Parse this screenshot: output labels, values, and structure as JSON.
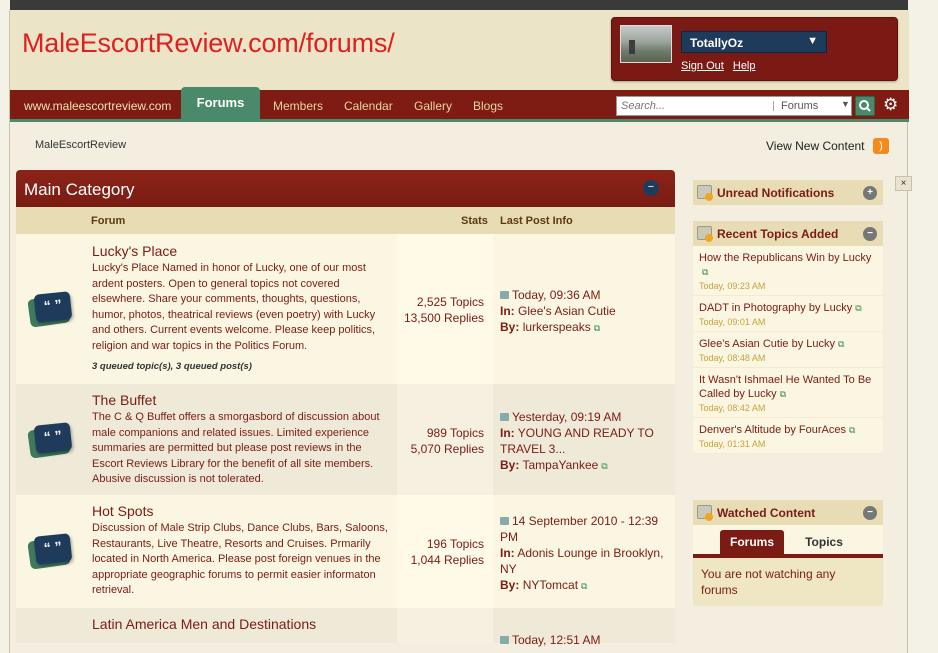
{
  "header": {
    "site_title": "MaleEscortReview.com/forums/",
    "username": "TotallyOz",
    "sign_out": "Sign Out",
    "help": "Help"
  },
  "nav": {
    "home": "www.maleescortreview.com",
    "items": [
      "Forums",
      "Members",
      "Calendar",
      "Gallery",
      "Blogs"
    ]
  },
  "search": {
    "placeholder": "Search...",
    "scope": "Forums"
  },
  "breadcrumb": "MaleEscortReview",
  "view_new": "View New Content",
  "category": {
    "title": "Main Category",
    "col_forum": "Forum",
    "col_stats": "Stats",
    "col_last": "Last Post Info"
  },
  "forums": [
    {
      "title": "Lucky's Place",
      "desc": "Lucky's Place Named in honor of Lucky, one of our most ardent posters. Open to general topics not covered elsewhere. Share your comments, thoughts, questions, humor, photos, theatrical reviews (even poetry) with Lucky and others. Current events welcome. Please keep politics, religion and war topics in the Politics Forum.",
      "queued": "3 queued topic(s), 3 queued post(s)",
      "topics": "2,525 Topics",
      "replies": "13,500 Replies",
      "last_time": "Today, 09:36 AM",
      "last_in": "Glee's Asian Cutie",
      "last_by": "lurkerspeaks"
    },
    {
      "title": "The Buffet",
      "desc": "The C & Q Buffet offers a smorgasbord of discussion about male companions and related issues. Limited experience summaries are permitted but please post reviews in the Escort Reviews Library for the benefit of all site members. Abusive discussion is not tolerated.",
      "topics": "989 Topics",
      "replies": "5,070 Replies",
      "last_time": "Yesterday, 09:19 AM",
      "last_in": "YOUNG AND READY TO TRAVEL 3...",
      "last_by": "TampaYankee"
    },
    {
      "title": "Hot Spots",
      "desc": "Discussion of Male Strip Clubs, Dance Clubs, Bars, Saloons, Restaurants, Live Theatre, Resorts and Cruises. Prmarily located in North America. Please post foreign venues in the appropriate geographic forums to permit easier informaton retrieval.",
      "topics": "196 Topics",
      "replies": "1,044 Replies",
      "last_time": "14 September 2010 - 12:39 PM",
      "last_in": "Adonis Lounge in Brooklyn, NY",
      "last_by": "NYTomcat"
    },
    {
      "title": "Latin America Men and Destinations",
      "last_time": "Today, 12:51 AM"
    }
  ],
  "labels": {
    "in": "In:",
    "by": "By:"
  },
  "sidebar": {
    "unread_title": "Unread Notifications",
    "recent_title": "Recent Topics Added",
    "recent": [
      {
        "title": "How the Republicans Win by Lucky",
        "time": "Today, 09:23 AM"
      },
      {
        "title": "DADT in Photography by Lucky",
        "time": "Today, 09:01 AM"
      },
      {
        "title": "Glee's Asian Cutie by Lucky",
        "time": "Today, 08:48 AM"
      },
      {
        "title": "It Wasn't Ishmael He Wanted To Be Called by Lucky",
        "time": "Today, 08:42 AM"
      },
      {
        "title": "Denver's Altitude by FourAces",
        "time": "Today, 01:31 AM"
      }
    ],
    "watched_title": "Watched Content",
    "watched_tabs": [
      "Forums",
      "Topics"
    ],
    "watched_msg": "You are not watching any forums"
  }
}
